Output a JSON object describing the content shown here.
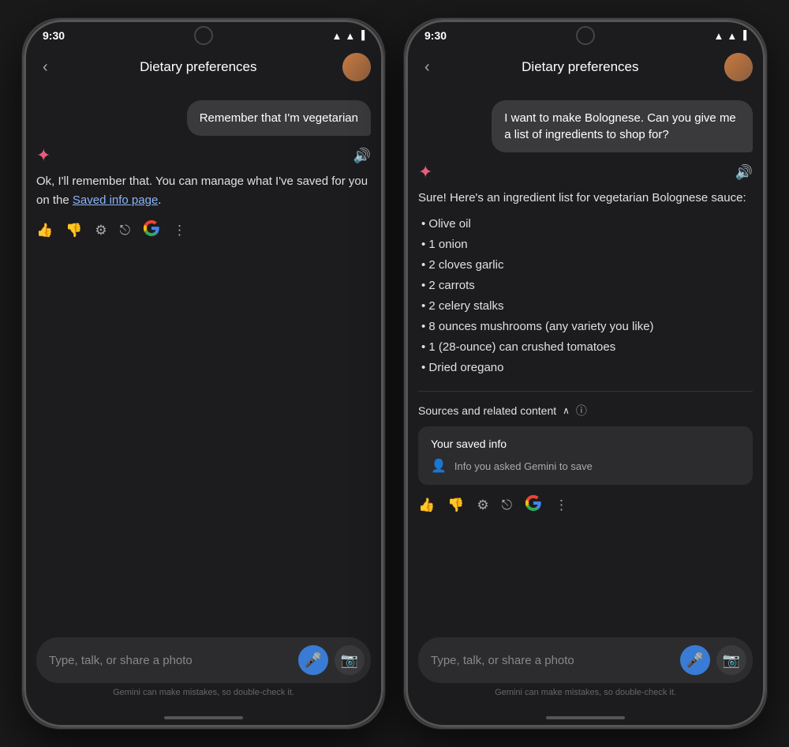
{
  "phone1": {
    "statusBar": {
      "time": "9:30"
    },
    "header": {
      "back": "‹",
      "title": "Dietary preferences"
    },
    "userMessage": "Remember that I'm vegetarian",
    "aiResponse": {
      "text": "Ok, I'll remember that. You can manage what I've saved for you on the ",
      "linkText": "Saved info page",
      "textAfterLink": "."
    },
    "actions": [
      "👍",
      "👎",
      "⚙️",
      "↗",
      "G",
      "⋮"
    ],
    "inputPlaceholder": "Type, talk, or share a photo",
    "disclaimer": "Gemini can make mistakes, so double-check it."
  },
  "phone2": {
    "statusBar": {
      "time": "9:30"
    },
    "header": {
      "back": "‹",
      "title": "Dietary preferences"
    },
    "userMessage": "I want to make Bolognese. Can you give me a list of ingredients to shop for?",
    "aiResponse": {
      "intro": "Sure! Here's an ingredient list for vegetarian Bolognese sauce:",
      "items": [
        "Olive oil",
        "1 onion",
        "2 cloves garlic",
        "2 carrots",
        "2 celery stalks",
        "8 ounces mushrooms (any variety you like)",
        "1 (28-ounce) can crushed tomatoes",
        "Dried oregano"
      ]
    },
    "sources": {
      "label": "Sources and related content",
      "card": {
        "title": "Your saved info",
        "row": "Info you asked Gemini to save"
      }
    },
    "inputPlaceholder": "Type, talk, or share a photo",
    "disclaimer": "Gemini can make mistakes, so double-check it."
  },
  "icons": {
    "star": "✦",
    "speaker": "🔊",
    "thumbUp": "👍",
    "thumbDown": "👎",
    "settings": "⚙",
    "share": "⎋",
    "more": "⋮",
    "mic": "🎤",
    "camera": "📷",
    "chevronUp": "∧",
    "info": "ℹ",
    "person": "👤",
    "back": "‹"
  }
}
